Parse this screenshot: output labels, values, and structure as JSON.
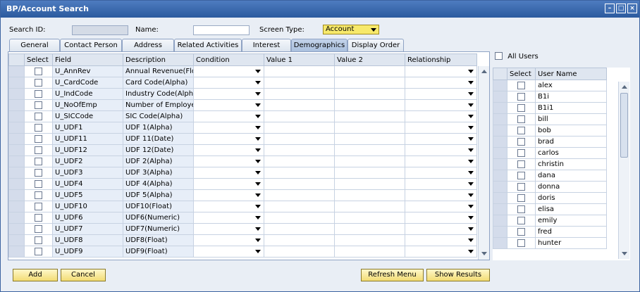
{
  "window": {
    "title": "BP/Account Search"
  },
  "header": {
    "search_id_label": "Search ID:",
    "search_id_value": "",
    "name_label": "Name:",
    "name_value": "",
    "screen_type_label": "Screen Type:",
    "screen_type_value": "Account"
  },
  "tabs": [
    "General",
    "Contact Person",
    "Address",
    "Related Activities",
    "Interest",
    "Demographics",
    "Display Order"
  ],
  "active_tab": "Demographics",
  "grid": {
    "headers": [
      "Select",
      "Field",
      "Description",
      "Condition",
      "Value 1",
      "Value 2",
      "Relationship"
    ],
    "rows": [
      {
        "field": "U_AnnRev",
        "description": "Annual Revenue(Float)"
      },
      {
        "field": "U_CardCode",
        "description": "Card Code(Alpha)"
      },
      {
        "field": "U_IndCode",
        "description": "Industry Code(Alpha)"
      },
      {
        "field": "U_NoOfEmp",
        "description": "Number of Employees"
      },
      {
        "field": "U_SICCode",
        "description": "SIC Code(Alpha)"
      },
      {
        "field": "U_UDF1",
        "description": "UDF 1(Alpha)"
      },
      {
        "field": "U_UDF11",
        "description": "UDF 11(Date)"
      },
      {
        "field": "U_UDF12",
        "description": "UDF 12(Date)"
      },
      {
        "field": "U_UDF2",
        "description": "UDF 2(Alpha)"
      },
      {
        "field": "U_UDF3",
        "description": "UDF 3(Alpha)"
      },
      {
        "field": "U_UDF4",
        "description": "UDF 4(Alpha)"
      },
      {
        "field": "U_UDF5",
        "description": "UDF 5(Alpha)"
      },
      {
        "field": "U_UDF10",
        "description": "UDF10(Float)"
      },
      {
        "field": "U_UDF6",
        "description": "UDF6(Numeric)"
      },
      {
        "field": "U_UDF7",
        "description": "UDF7(Numeric)"
      },
      {
        "field": "U_UDF8",
        "description": "UDF8(Float)"
      },
      {
        "field": "U_UDF9",
        "description": "UDF9(Float)"
      }
    ]
  },
  "users_panel": {
    "all_users_label": "All Users",
    "headers": [
      "Select",
      "User Name"
    ],
    "users": [
      "alex",
      "B1i",
      "B1i1",
      "bill",
      "bob",
      "brad",
      "carlos",
      "christin",
      "dana",
      "donna",
      "doris",
      "elisa",
      "emily",
      "fred",
      "hunter"
    ]
  },
  "buttons": {
    "add": "Add",
    "cancel": "Cancel",
    "refresh_menu": "Refresh Menu",
    "show_results": "Show Results"
  },
  "titlebar_icons": [
    "minimize-icon",
    "maximize-icon",
    "close-icon"
  ],
  "colors": {
    "titlebar": "#2b5a9e",
    "accent_yellow": "#f7e96b",
    "button_yellow": "#f2dc74"
  }
}
